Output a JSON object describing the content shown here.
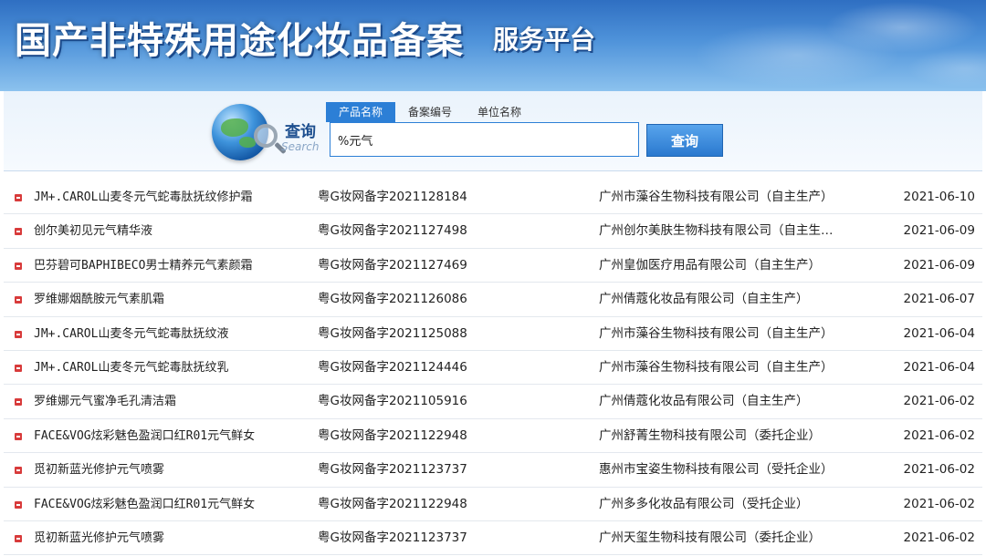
{
  "banner": {
    "title": "国产非特殊用途化妆品备案",
    "subtitle": "服务平台"
  },
  "search": {
    "label": "查询",
    "label_en": "Search",
    "tabs": [
      {
        "label": "产品名称",
        "active": true
      },
      {
        "label": "备案编号",
        "active": false
      },
      {
        "label": "单位名称",
        "active": false
      }
    ],
    "query_value": "%元气",
    "button_label": "查询"
  },
  "results": [
    {
      "name": "JM+.CAROL山麦冬元气蛇毒肽抚纹修护霜",
      "reg": "粤G妆网备字2021128184",
      "company": "广州市藻谷生物科技有限公司（自主生产）",
      "date": "2021-06-10"
    },
    {
      "name": "创尔美初见元气精华液",
      "reg": "粤G妆网备字2021127498",
      "company": "广州创尔美肤生物科技有限公司（自主生…",
      "date": "2021-06-09"
    },
    {
      "name": "巴芬碧可BAPHIBECO男士精养元气素颜霜",
      "reg": "粤G妆网备字2021127469",
      "company": "广州皇伽医疗用品有限公司（自主生产）",
      "date": "2021-06-09"
    },
    {
      "name": "罗维娜烟酰胺元气素肌霜",
      "reg": "粤G妆网备字2021126086",
      "company": "广州倩蔻化妆品有限公司（自主生产）",
      "date": "2021-06-07"
    },
    {
      "name": "JM+.CAROL山麦冬元气蛇毒肽抚纹液",
      "reg": "粤G妆网备字2021125088",
      "company": "广州市藻谷生物科技有限公司（自主生产）",
      "date": "2021-06-04"
    },
    {
      "name": "JM+.CAROL山麦冬元气蛇毒肽抚纹乳",
      "reg": "粤G妆网备字2021124446",
      "company": "广州市藻谷生物科技有限公司（自主生产）",
      "date": "2021-06-04"
    },
    {
      "name": "罗维娜元气蜜净毛孔清洁霜",
      "reg": "粤G妆网备字2021105916",
      "company": "广州倩蔻化妆品有限公司（自主生产）",
      "date": "2021-06-02"
    },
    {
      "name": "FACE&VOG炫彩魅色盈润口红R01元气鲜女",
      "reg": "粤G妆网备字2021122948",
      "company": "广州舒菁生物科技有限公司（委托企业）",
      "date": "2021-06-02"
    },
    {
      "name": "觅初新蓝光修护元气喷雾",
      "reg": "粤G妆网备字2021123737",
      "company": "惠州市宝姿生物科技有限公司（受托企业）",
      "date": "2021-06-02"
    },
    {
      "name": "FACE&VOG炫彩魅色盈润口红R01元气鲜女",
      "reg": "粤G妆网备字2021122948",
      "company": "广州多多化妆品有限公司（受托企业）",
      "date": "2021-06-02"
    },
    {
      "name": "觅初新蓝光修护元气喷雾",
      "reg": "粤G妆网备字2021123737",
      "company": "广州天玺生物科技有限公司（委托企业）",
      "date": "2021-06-02"
    }
  ]
}
